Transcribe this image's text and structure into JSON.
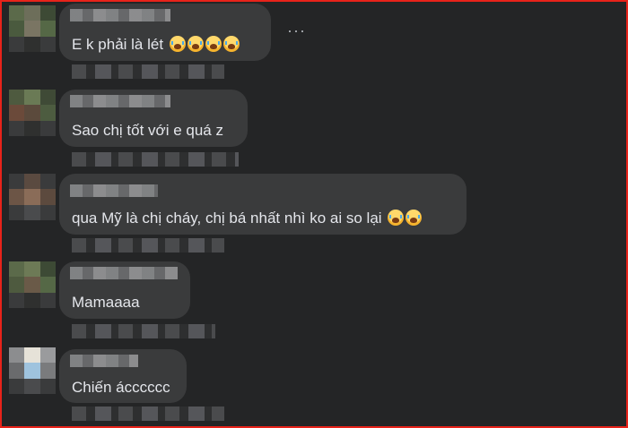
{
  "more_menu_label": "···",
  "comments": [
    {
      "text": "E k phải là lét",
      "emoji_count": 4
    },
    {
      "text": "Sao chị tốt với e quá z",
      "emoji_count": 0
    },
    {
      "text": "qua Mỹ là chị cháy, chị bá nhất nhì ko ai so lại",
      "emoji_count": 2
    },
    {
      "text": "Mamaaaa",
      "emoji_count": 0
    },
    {
      "text": "Chiến ácccccc",
      "emoji_count": 0
    }
  ],
  "colors": {
    "frame_border": "#e8231a",
    "background": "#242526",
    "bubble": "#3a3b3c",
    "text": "#e4e6eb"
  }
}
